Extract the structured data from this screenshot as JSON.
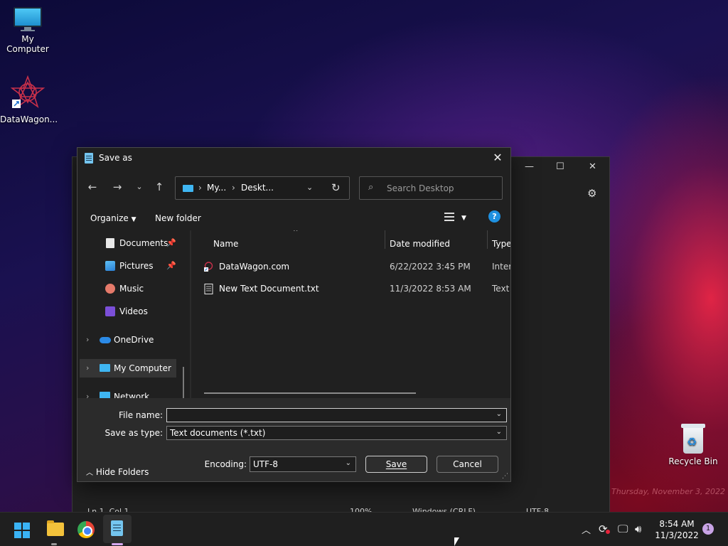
{
  "desktop": {
    "icons": [
      {
        "label": "My Computer"
      },
      {
        "label": "DataWagon..."
      },
      {
        "label": "Recycle Bin"
      }
    ],
    "watermark": "Thursday, November 3, 2022"
  },
  "background_window": {
    "status": {
      "position": "Ln 1, Col 1",
      "zoom": "100%",
      "line_ending": "Windows (CRLF)",
      "encoding": "UTF-8"
    }
  },
  "dialog": {
    "title": "Save as",
    "address": {
      "crumb1": "My...",
      "crumb2": "Deskt..."
    },
    "search_placeholder": "Search Desktop",
    "commands": {
      "organize": "Organize",
      "new_folder": "New folder"
    },
    "nav_items": [
      {
        "label": "Documents"
      },
      {
        "label": "Pictures"
      },
      {
        "label": "Music"
      },
      {
        "label": "Videos"
      },
      {
        "label": "OneDrive"
      },
      {
        "label": "My Computer"
      },
      {
        "label": "Network"
      }
    ],
    "columns": {
      "name": "Name",
      "date": "Date modified",
      "type": "Type"
    },
    "files": [
      {
        "name": "DataWagon.com",
        "date": "6/22/2022 3:45 PM",
        "type": "Intern"
      },
      {
        "name": "New Text Document.txt",
        "date": "11/3/2022 8:53 AM",
        "type": "Text D"
      }
    ],
    "file_name_label": "File name:",
    "file_name_value": "",
    "save_type_label": "Save as type:",
    "save_type_value": "Text documents (*.txt)",
    "encoding_label": "Encoding:",
    "encoding_value": "UTF-8",
    "save_label": "Save",
    "cancel_label": "Cancel",
    "hide_folders_label": "Hide Folders"
  },
  "taskbar": {
    "time": "8:54 AM",
    "date": "11/3/2022",
    "notification_count": "1"
  }
}
